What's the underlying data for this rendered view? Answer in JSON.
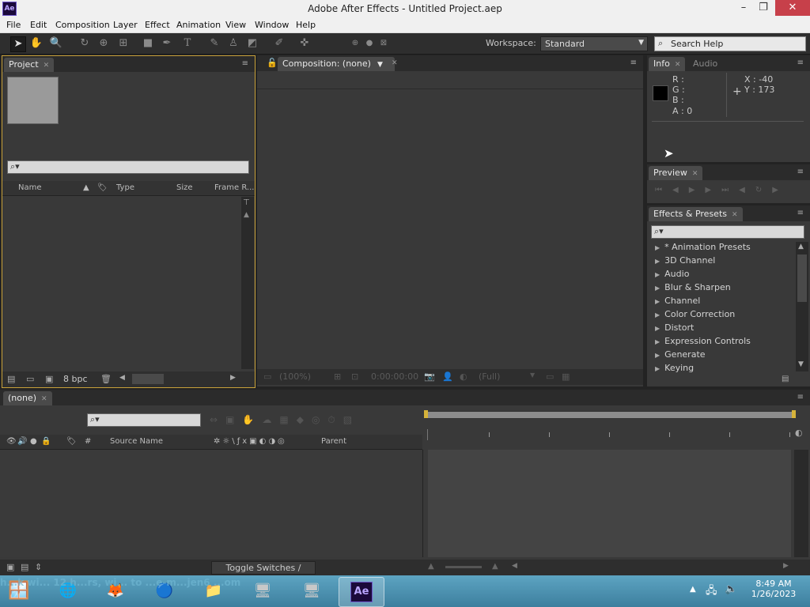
{
  "window": {
    "title": "Adobe After Effects - Untitled Project.aep",
    "app_icon": "Ae",
    "min": "–",
    "restore": "❐",
    "close": "✕"
  },
  "menu": [
    "File",
    "Edit",
    "Composition",
    "Layer",
    "Effect",
    "Animation",
    "View",
    "Window",
    "Help"
  ],
  "toolbar": {
    "workspace_label": "Workspace:",
    "workspace_value": "Standard",
    "search_help_placeholder": "Search Help"
  },
  "project": {
    "tab": "Project",
    "columns": [
      "Name",
      "Type",
      "Size",
      "Frame R..."
    ],
    "bpc": "8 bpc"
  },
  "composition": {
    "tab": "Composition: (none)",
    "zoom": "(100%)",
    "timecode": "0:00:00:00",
    "resolution": "(Full)"
  },
  "info": {
    "tab": "Info",
    "tab2": "Audio",
    "r": "R :",
    "g": "G :",
    "b": "B :",
    "a": "A : 0",
    "x": "X : -40",
    "y": "Y : 173"
  },
  "preview": {
    "tab": "Preview"
  },
  "effects": {
    "tab": "Effects & Presets",
    "items": [
      "* Animation Presets",
      "3D Channel",
      "Audio",
      "Blur & Sharpen",
      "Channel",
      "Color Correction",
      "Distort",
      "Expression Controls",
      "Generate",
      "Keying"
    ]
  },
  "timeline": {
    "tab": "(none)",
    "col_hash": "#",
    "col_source": "Source Name",
    "col_parent": "Parent",
    "toggle_label": "Toggle Switches / Modes"
  },
  "taskbar": {
    "time": "8:49 AM",
    "date": "1/26/2023",
    "watermark": "h...k wi... 12 h...rs, wi... to ...e-m...jen6 ...om",
    "ae_label": "Ae"
  }
}
